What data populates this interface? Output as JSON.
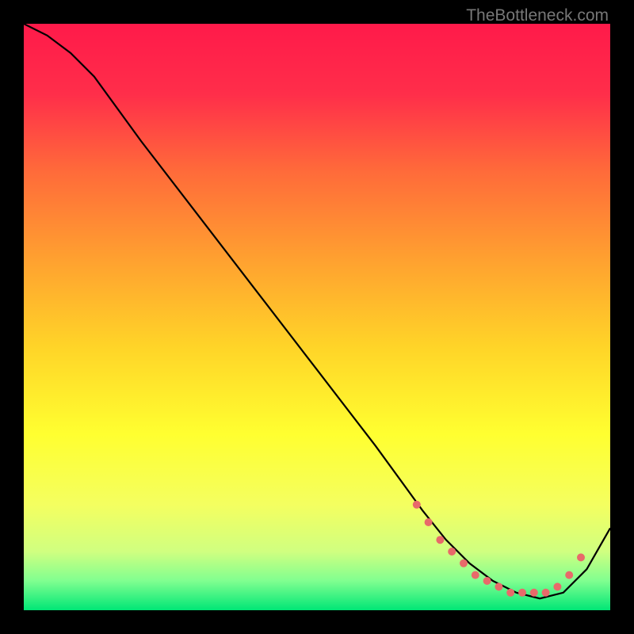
{
  "watermark": "TheBottleneck.com",
  "chart_data": {
    "type": "line",
    "title": "",
    "xlabel": "",
    "ylabel": "",
    "xlim": [
      0,
      100
    ],
    "ylim": [
      0,
      100
    ],
    "gradient_stops": [
      {
        "pos": 0.0,
        "color": "#ff1a4a"
      },
      {
        "pos": 0.12,
        "color": "#ff2e4a"
      },
      {
        "pos": 0.25,
        "color": "#ff6a3a"
      },
      {
        "pos": 0.4,
        "color": "#ffa030"
      },
      {
        "pos": 0.55,
        "color": "#ffd428"
      },
      {
        "pos": 0.7,
        "color": "#ffff30"
      },
      {
        "pos": 0.82,
        "color": "#f4ff60"
      },
      {
        "pos": 0.9,
        "color": "#d0ff80"
      },
      {
        "pos": 0.95,
        "color": "#80ff90"
      },
      {
        "pos": 1.0,
        "color": "#00e676"
      }
    ],
    "series": [
      {
        "name": "curve",
        "x": [
          0,
          4,
          8,
          12,
          20,
          30,
          40,
          50,
          60,
          68,
          72,
          76,
          80,
          84,
          88,
          92,
          96,
          100
        ],
        "y": [
          100,
          98,
          95,
          91,
          80,
          67,
          54,
          41,
          28,
          17,
          12,
          8,
          5,
          3,
          2,
          3,
          7,
          14
        ]
      }
    ],
    "markers": {
      "name": "highlight-points",
      "x": [
        67,
        69,
        71,
        73,
        75,
        77,
        79,
        81,
        83,
        85,
        87,
        89,
        91,
        93,
        95
      ],
      "y": [
        18,
        15,
        12,
        10,
        8,
        6,
        5,
        4,
        3,
        3,
        3,
        3,
        4,
        6,
        9
      ],
      "color": "#e86a6a",
      "radius": 5
    }
  }
}
